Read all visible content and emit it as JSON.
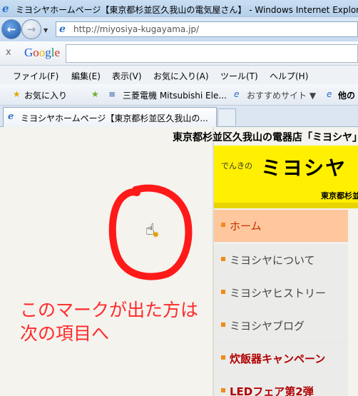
{
  "window": {
    "title": "ミヨシヤホームページ【東京都杉並区久我山の電気屋さん】 - Windows Internet Explorer"
  },
  "address": {
    "url": "http://miyosiya-kugayama.jp/"
  },
  "googlebar": {
    "close": "x",
    "logo": "Google"
  },
  "menubar": {
    "items": [
      "ファイル(F)",
      "編集(E)",
      "表示(V)",
      "お気に入り(A)",
      "ツール(T)",
      "ヘルプ(H)"
    ]
  },
  "favbar": {
    "favorites": "お気に入り",
    "mitsubishi": "三菱電機 Mitsubishi Ele...",
    "recommended": "おすすめサイト ▼",
    "other": "他の"
  },
  "tab": {
    "title": "ミヨシヤホームページ【東京都杉並区久我山の..."
  },
  "site": {
    "header": "東京都杉並区久我山の電器店「ミヨシヤ」",
    "logo_small": "でんきの",
    "logo_big": "ミヨシヤ",
    "logo_region": "東京都杉並区",
    "nav": [
      "ホーム",
      "ミヨシヤについて",
      "ミヨシヤヒストリー",
      "ミヨシヤブログ",
      "炊飯器キャンペーン",
      "LEDフェア第2弾"
    ]
  },
  "annotation": {
    "line1": "このマークが出た方は",
    "line2": "次の項目へ"
  },
  "colors": {
    "annotation": "#ff2a2a",
    "logo_bg": "#ffef00",
    "active_nav": "#fec79e"
  }
}
